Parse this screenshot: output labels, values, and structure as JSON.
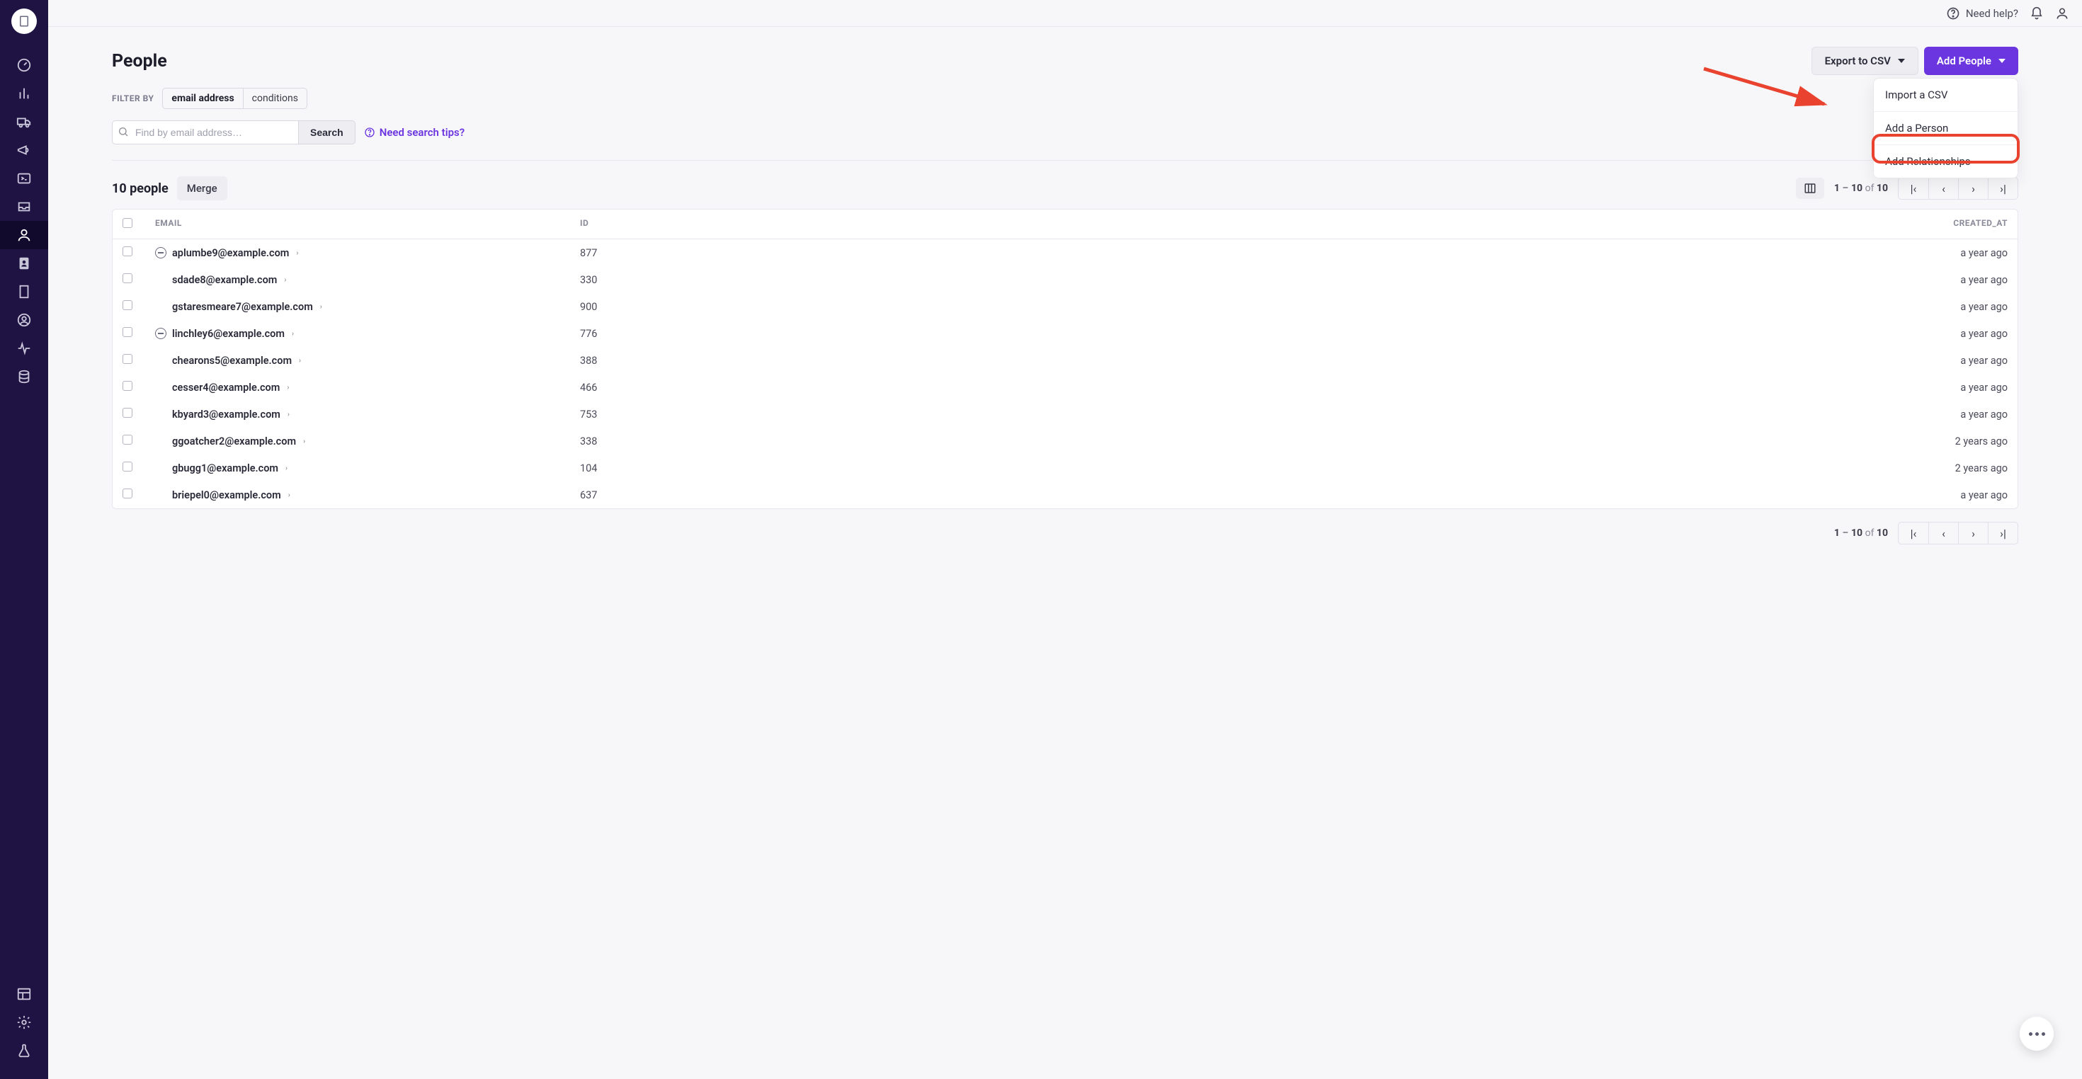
{
  "topbar": {
    "help": "Need help?"
  },
  "sidebar": {
    "icons": [
      "gauge",
      "bar-chart",
      "truck",
      "megaphone",
      "terminal",
      "inbox",
      "user",
      "id-badge",
      "building",
      "target",
      "activity",
      "database"
    ],
    "bottom": [
      "layout",
      "gear",
      "flask"
    ],
    "active_index": 6
  },
  "page": {
    "title": "People"
  },
  "actions": {
    "export_label": "Export to CSV",
    "add_label": "Add People",
    "dropdown": [
      "Import a CSV",
      "Add a Person",
      "Add Relationships"
    ]
  },
  "filters": {
    "label": "Filter by",
    "chips": [
      "email address",
      "conditions"
    ],
    "selected": 0
  },
  "search": {
    "placeholder": "Find by email address…",
    "button": "Search",
    "tips": "Need search tips?"
  },
  "summary": {
    "count_label": "10 people",
    "merge": "Merge"
  },
  "pagination": {
    "range_from": "1",
    "range_to": "10",
    "of_word": "of",
    "total": "10"
  },
  "columns": {
    "email": "Email",
    "id": "ID",
    "created": "created_at"
  },
  "rows": [
    {
      "email": "aplumbe9@example.com",
      "id": "877",
      "created": "a year ago",
      "sub": true
    },
    {
      "email": "sdade8@example.com",
      "id": "330",
      "created": "a year ago",
      "sub": false
    },
    {
      "email": "gstaresmeare7@example.com",
      "id": "900",
      "created": "a year ago",
      "sub": false
    },
    {
      "email": "linchley6@example.com",
      "id": "776",
      "created": "a year ago",
      "sub": true
    },
    {
      "email": "chearons5@example.com",
      "id": "388",
      "created": "a year ago",
      "sub": false
    },
    {
      "email": "cesser4@example.com",
      "id": "466",
      "created": "a year ago",
      "sub": false
    },
    {
      "email": "kbyard3@example.com",
      "id": "753",
      "created": "a year ago",
      "sub": false
    },
    {
      "email": "ggoatcher2@example.com",
      "id": "338",
      "created": "2 years ago",
      "sub": false
    },
    {
      "email": "gbugg1@example.com",
      "id": "104",
      "created": "2 years ago",
      "sub": false
    },
    {
      "email": "briepel0@example.com",
      "id": "637",
      "created": "a year ago",
      "sub": false
    }
  ]
}
